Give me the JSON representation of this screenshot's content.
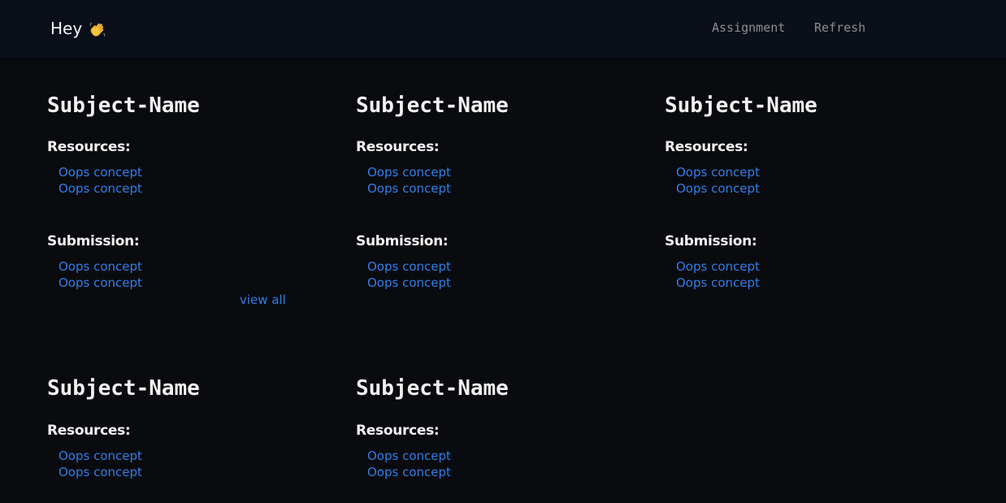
{
  "header": {
    "greeting": "Hey",
    "nav": [
      {
        "label": "Assignment"
      },
      {
        "label": "Refresh"
      }
    ]
  },
  "subjects": [
    {
      "title": "Subject-Name",
      "resources_label": "Resources:",
      "resources": [
        "Oops concept",
        "Oops concept"
      ],
      "submission_label": "Submission:",
      "submissions": [
        "Oops concept",
        "Oops concept"
      ],
      "view_all": "view all"
    },
    {
      "title": "Subject-Name",
      "resources_label": "Resources:",
      "resources": [
        "Oops concept",
        "Oops concept"
      ],
      "submission_label": "Submission:",
      "submissions": [
        "Oops concept",
        "Oops concept"
      ]
    },
    {
      "title": "Subject-Name",
      "resources_label": "Resources:",
      "resources": [
        "Oops concept",
        "Oops concept"
      ],
      "submission_label": "Submission:",
      "submissions": [
        "Oops concept",
        "Oops concept"
      ]
    },
    {
      "title": "Subject-Name",
      "resources_label": "Resources:",
      "resources": [
        "Oops concept",
        "Oops concept"
      ]
    },
    {
      "title": "Subject-Name",
      "resources_label": "Resources:",
      "resources": [
        "Oops concept",
        "Oops concept"
      ]
    }
  ],
  "colors": {
    "background": "#0a0b0f",
    "navbar": "#0a0f1a",
    "link": "#2f7fea",
    "text": "#f1f1f1",
    "nav_text": "#8d8d8d"
  },
  "icons": {
    "greeting": "waving-hand-icon"
  }
}
